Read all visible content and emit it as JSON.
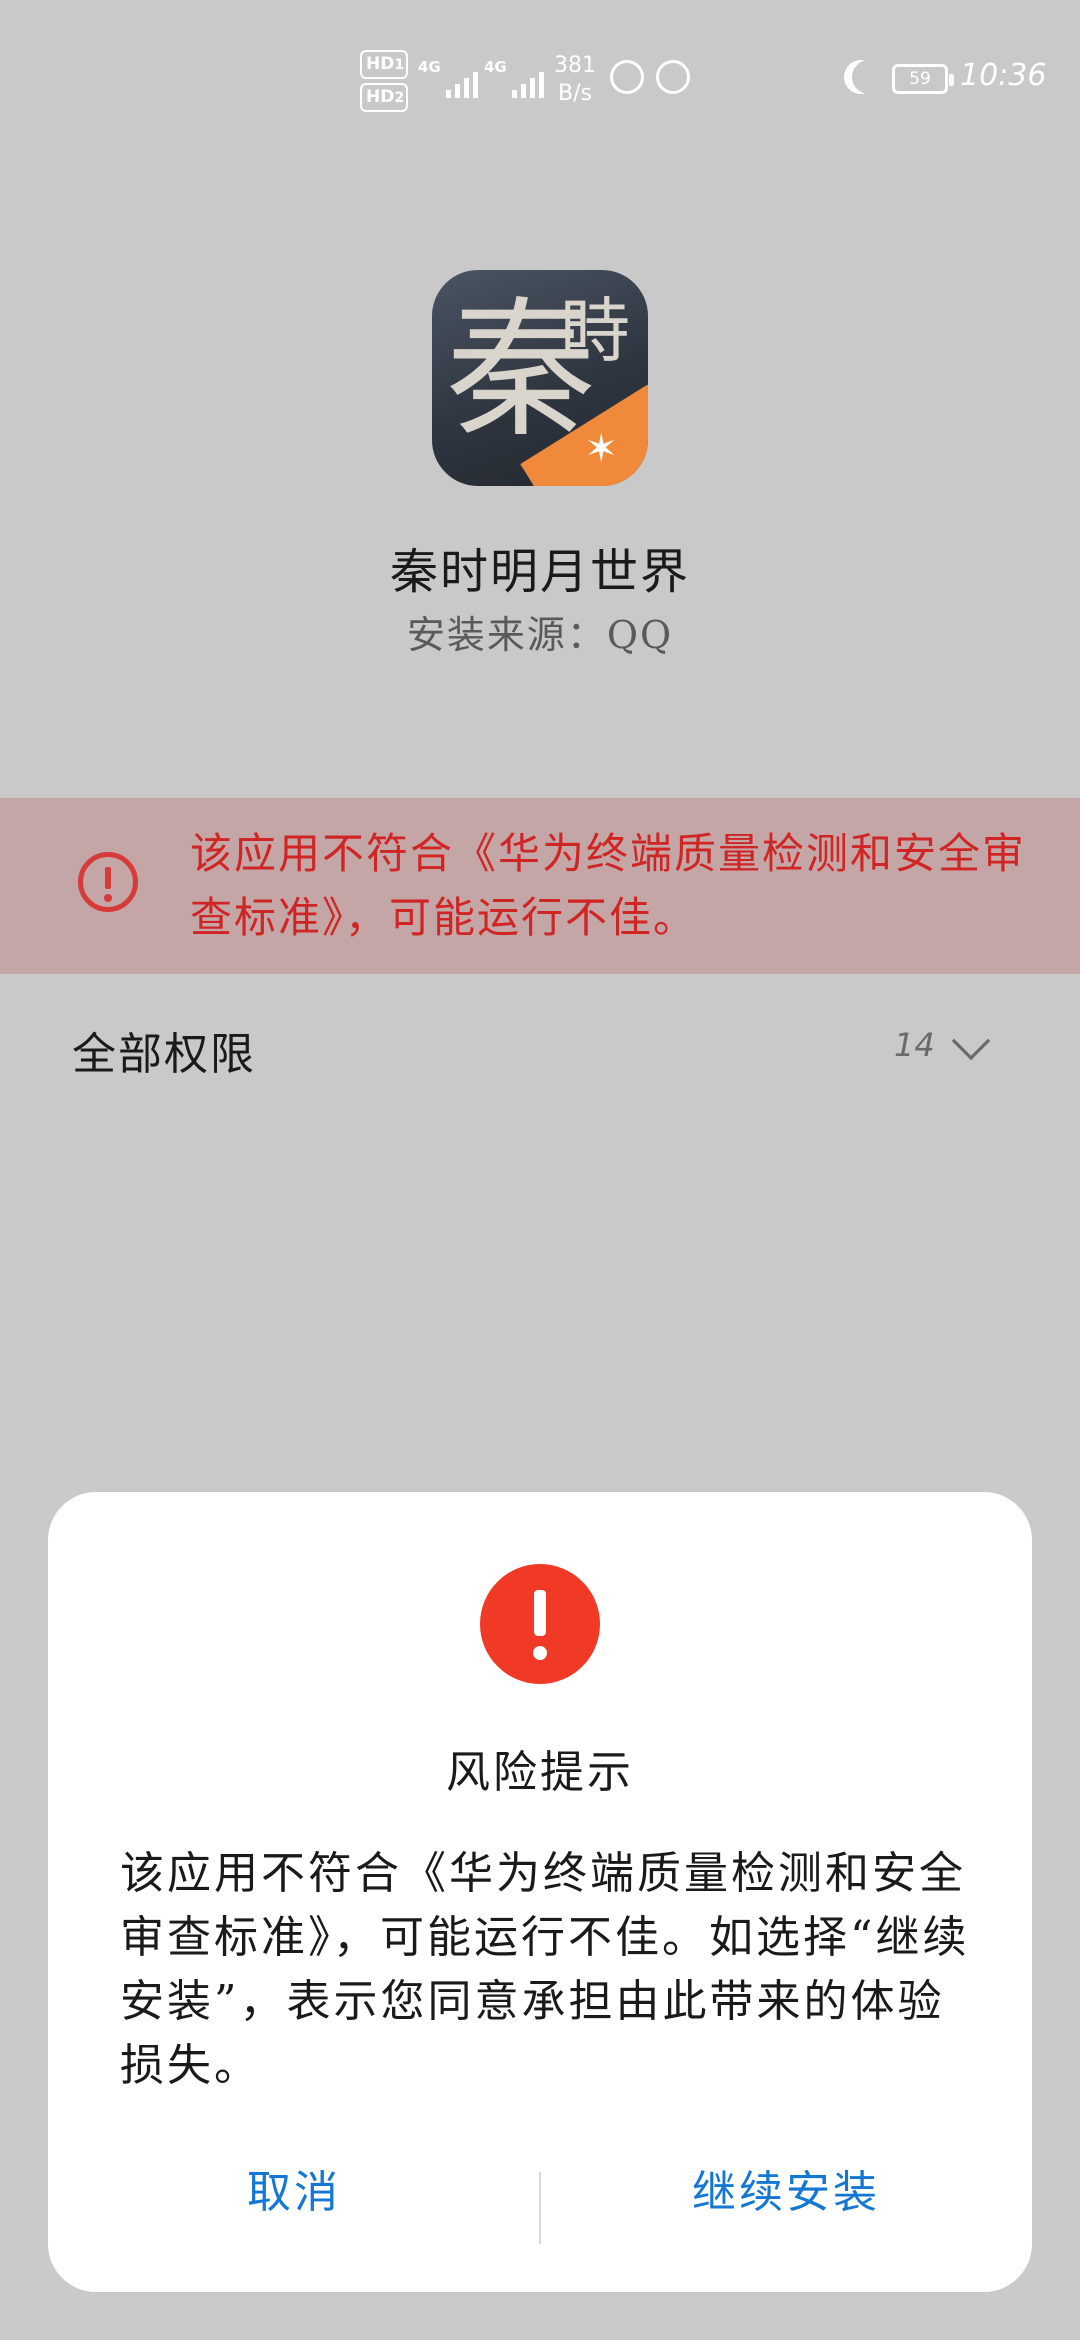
{
  "status_bar": {
    "hd1": "HD",
    "hd1_sub": "1",
    "hd2": "HD",
    "hd2_sub": "2",
    "sim1_label": "4G",
    "sim2_label": "4G",
    "speed_value": "381",
    "speed_unit": "B/s",
    "battery": "59",
    "time": "10:36"
  },
  "app": {
    "icon_chars": [
      "秦",
      "時"
    ],
    "name": "秦时明月世界",
    "source": "安装来源：QQ"
  },
  "banner": {
    "text": "该应用不符合《华为终端质量检测和安全审查标准》，可能运行不佳。"
  },
  "permissions": {
    "title": "全部权限",
    "count": "14"
  },
  "dialog": {
    "title": "风险提示",
    "body": "该应用不符合《华为终端质量检测和安全审查标准》，可能运行不佳。如选择“继续安装”，表示您同意承担由此带来的体验损失。",
    "cancel_label": "取消",
    "confirm_label": "继续安装"
  },
  "colors": {
    "warning_red": "#d02525",
    "button_blue": "#1477d4",
    "alert_icon_red": "#f03a26",
    "dim_background": "#c9c9c9"
  }
}
